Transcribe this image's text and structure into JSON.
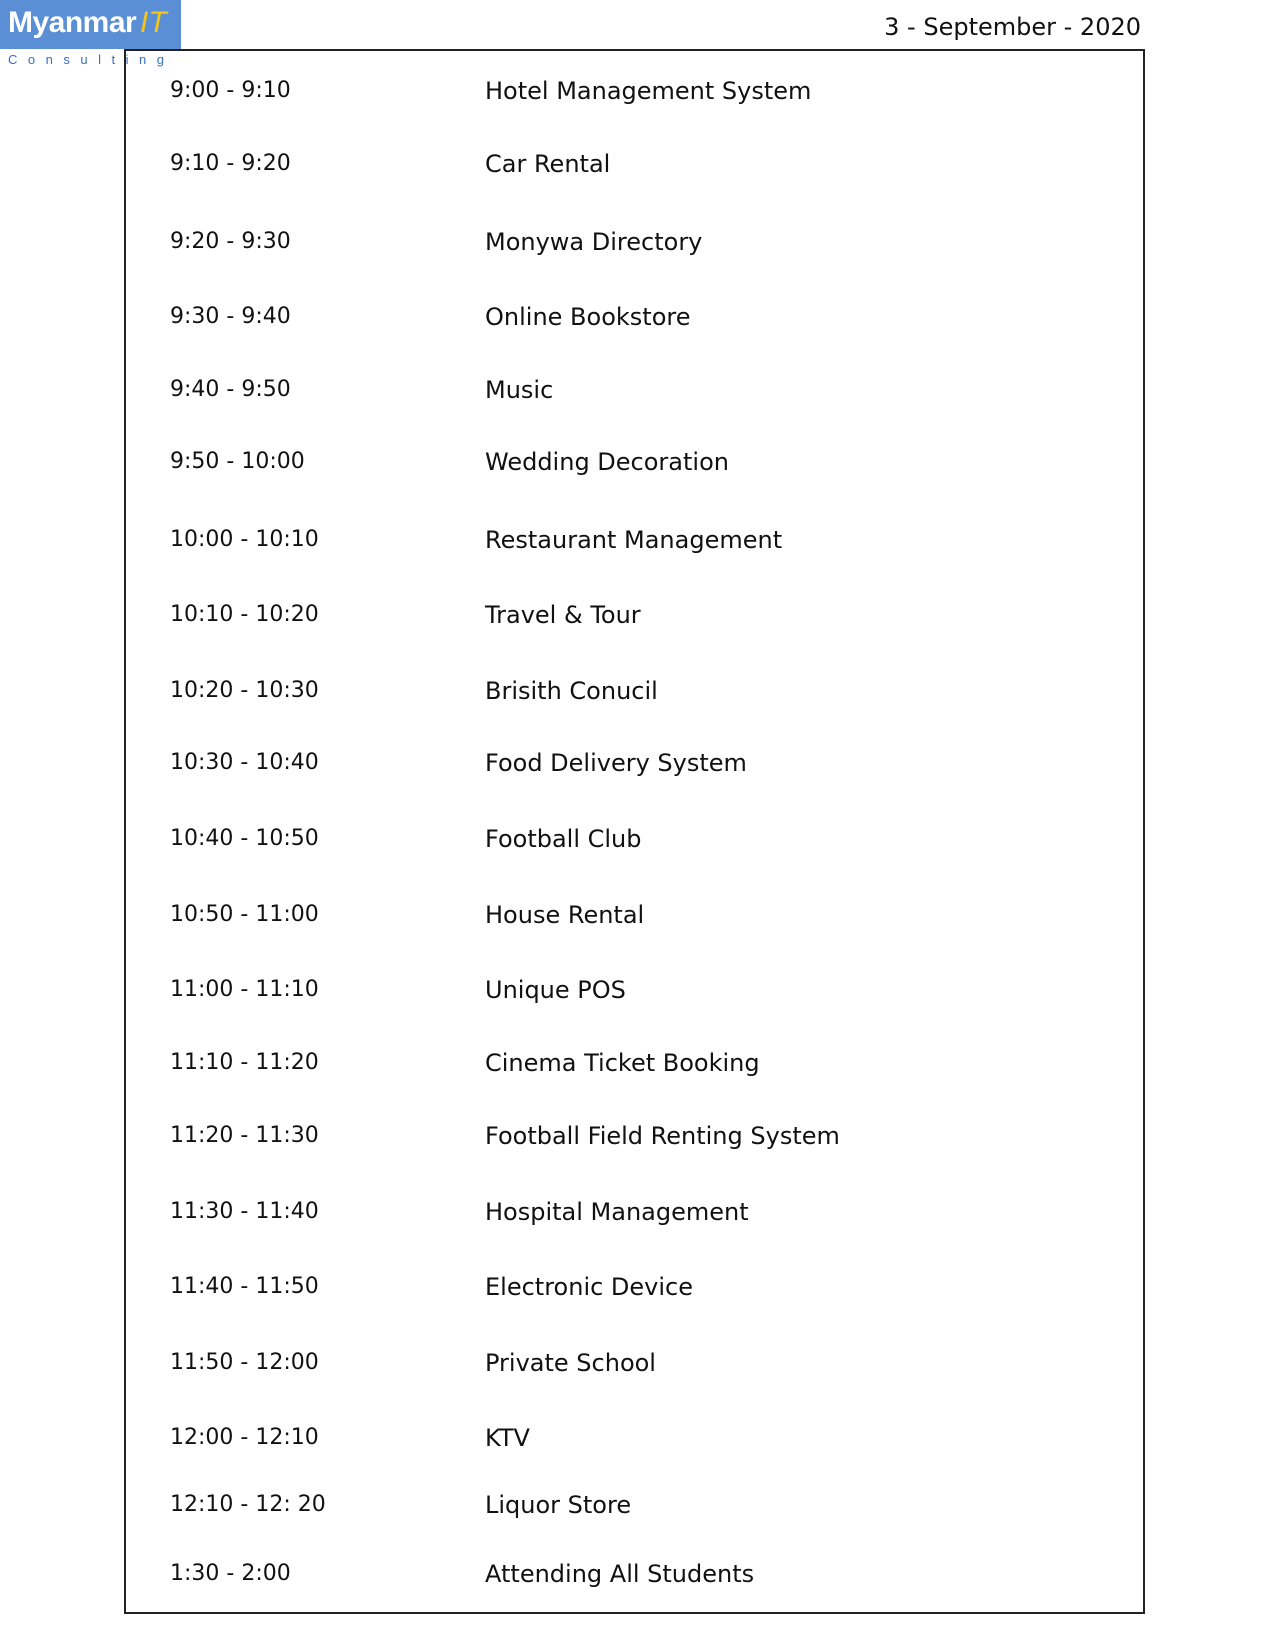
{
  "header": {
    "logo_main": "Myanmar",
    "logo_accent": "IT",
    "logo_sub": "Consulting",
    "date": "3 - September - 2020"
  },
  "schedule": [
    {
      "time": "9:00 - 9:10",
      "title": "Hotel Management System"
    },
    {
      "time": "9:10 - 9:20",
      "title": "Car Rental"
    },
    {
      "time": "9:20 - 9:30",
      "title": "Monywa Directory"
    },
    {
      "time": "9:30 - 9:40",
      "title": "Online Bookstore"
    },
    {
      "time": "9:40 - 9:50",
      "title": "Music"
    },
    {
      "time": "9:50 - 10:00",
      "title": "Wedding Decoration"
    },
    {
      "time": "10:00 - 10:10",
      "title": "Restaurant Management"
    },
    {
      "time": "10:10 - 10:20",
      "title": "Travel & Tour"
    },
    {
      "time": "10:20 - 10:30",
      "title": "Brisith Conucil"
    },
    {
      "time": "10:30 - 10:40",
      "title": "Food Delivery System"
    },
    {
      "time": "10:40 - 10:50",
      "title": "Football Club"
    },
    {
      "time": "10:50 - 11:00",
      "title": "House Rental"
    },
    {
      "time": "11:00 - 11:10",
      "title": "Unique POS"
    },
    {
      "time": "11:10 - 11:20",
      "title": "Cinema Ticket Booking"
    },
    {
      "time": "11:20 - 11:30",
      "title": "Football Field Renting System"
    },
    {
      "time": "11:30 - 11:40",
      "title": "Hospital Management"
    },
    {
      "time": "11:40 - 11:50",
      "title": "Electronic Device"
    },
    {
      "time": "11:50 - 12:00",
      "title": "Private School"
    },
    {
      "time": "12:00 - 12:10",
      "title": "KTV"
    },
    {
      "time": "12:10 - 12: 20",
      "title": "Liquor Store"
    },
    {
      "time": "1:30 - 2:00",
      "title": "Attending All Students"
    }
  ]
}
